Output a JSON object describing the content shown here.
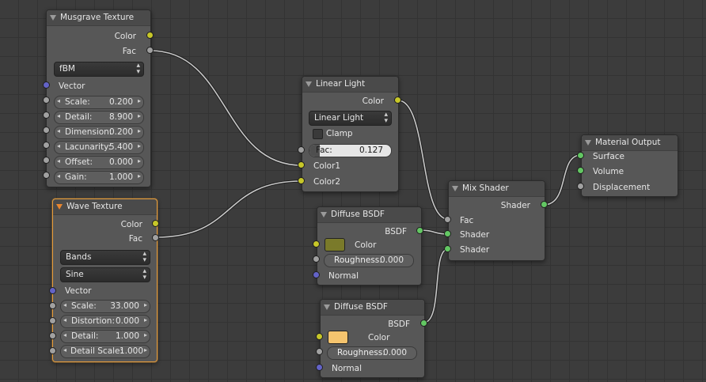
{
  "nodes": {
    "musgrave": {
      "title": "Musgrave Texture",
      "outputs": [
        "Color",
        "Fac"
      ],
      "type_dropdown": "fBM",
      "vector_label": "Vector",
      "fields": [
        {
          "label": "Scale:",
          "value": "0.200"
        },
        {
          "label": "Detail:",
          "value": "8.900"
        },
        {
          "label": "Dimension:",
          "value": "0.200"
        },
        {
          "label": "Lacunarity:",
          "value": "5.400"
        },
        {
          "label": "Offset:",
          "value": "0.000"
        },
        {
          "label": "Gain:",
          "value": "1.000"
        }
      ]
    },
    "wave": {
      "title": "Wave Texture",
      "outputs": [
        "Color",
        "Fac"
      ],
      "type_dropdown": "Bands",
      "profile_dropdown": "Sine",
      "vector_label": "Vector",
      "fields": [
        {
          "label": "Scale:",
          "value": "33.000"
        },
        {
          "label": "Distortion:",
          "value": "0.000"
        },
        {
          "label": "Detail:",
          "value": "1.000"
        },
        {
          "label": "Detail Scale:",
          "value": "1.000"
        }
      ]
    },
    "linear_light": {
      "title": "Linear Light",
      "output": "Color",
      "blend_dropdown": "Linear Light",
      "clamp_label": "Clamp",
      "clamp_checked": false,
      "fac": {
        "label": "Fac:",
        "value": "0.127",
        "fraction": 0.127
      },
      "inputs": [
        "Color1",
        "Color2"
      ]
    },
    "diffuse1": {
      "title": "Diffuse BSDF",
      "output": "BSDF",
      "color_label": "Color",
      "color": "#7a7a2a",
      "roughness": {
        "label": "Roughness:",
        "value": "0.000"
      },
      "normal_label": "Normal"
    },
    "diffuse2": {
      "title": "Diffuse BSDF",
      "output": "BSDF",
      "color_label": "Color",
      "color": "#f5c46e",
      "roughness": {
        "label": "Roughness:",
        "value": "0.000"
      },
      "normal_label": "Normal"
    },
    "mix_shader": {
      "title": "Mix Shader",
      "output": "Shader",
      "inputs": [
        "Fac",
        "Shader",
        "Shader"
      ]
    },
    "material_output": {
      "title": "Material Output",
      "inputs": [
        "Surface",
        "Volume",
        "Displacement"
      ]
    }
  },
  "colors": {
    "socket_color": "#c7c729",
    "socket_float": "#a1a1a1",
    "socket_vector": "#6363c7",
    "socket_shader": "#63c763",
    "active_outline": "#e59d3d"
  }
}
